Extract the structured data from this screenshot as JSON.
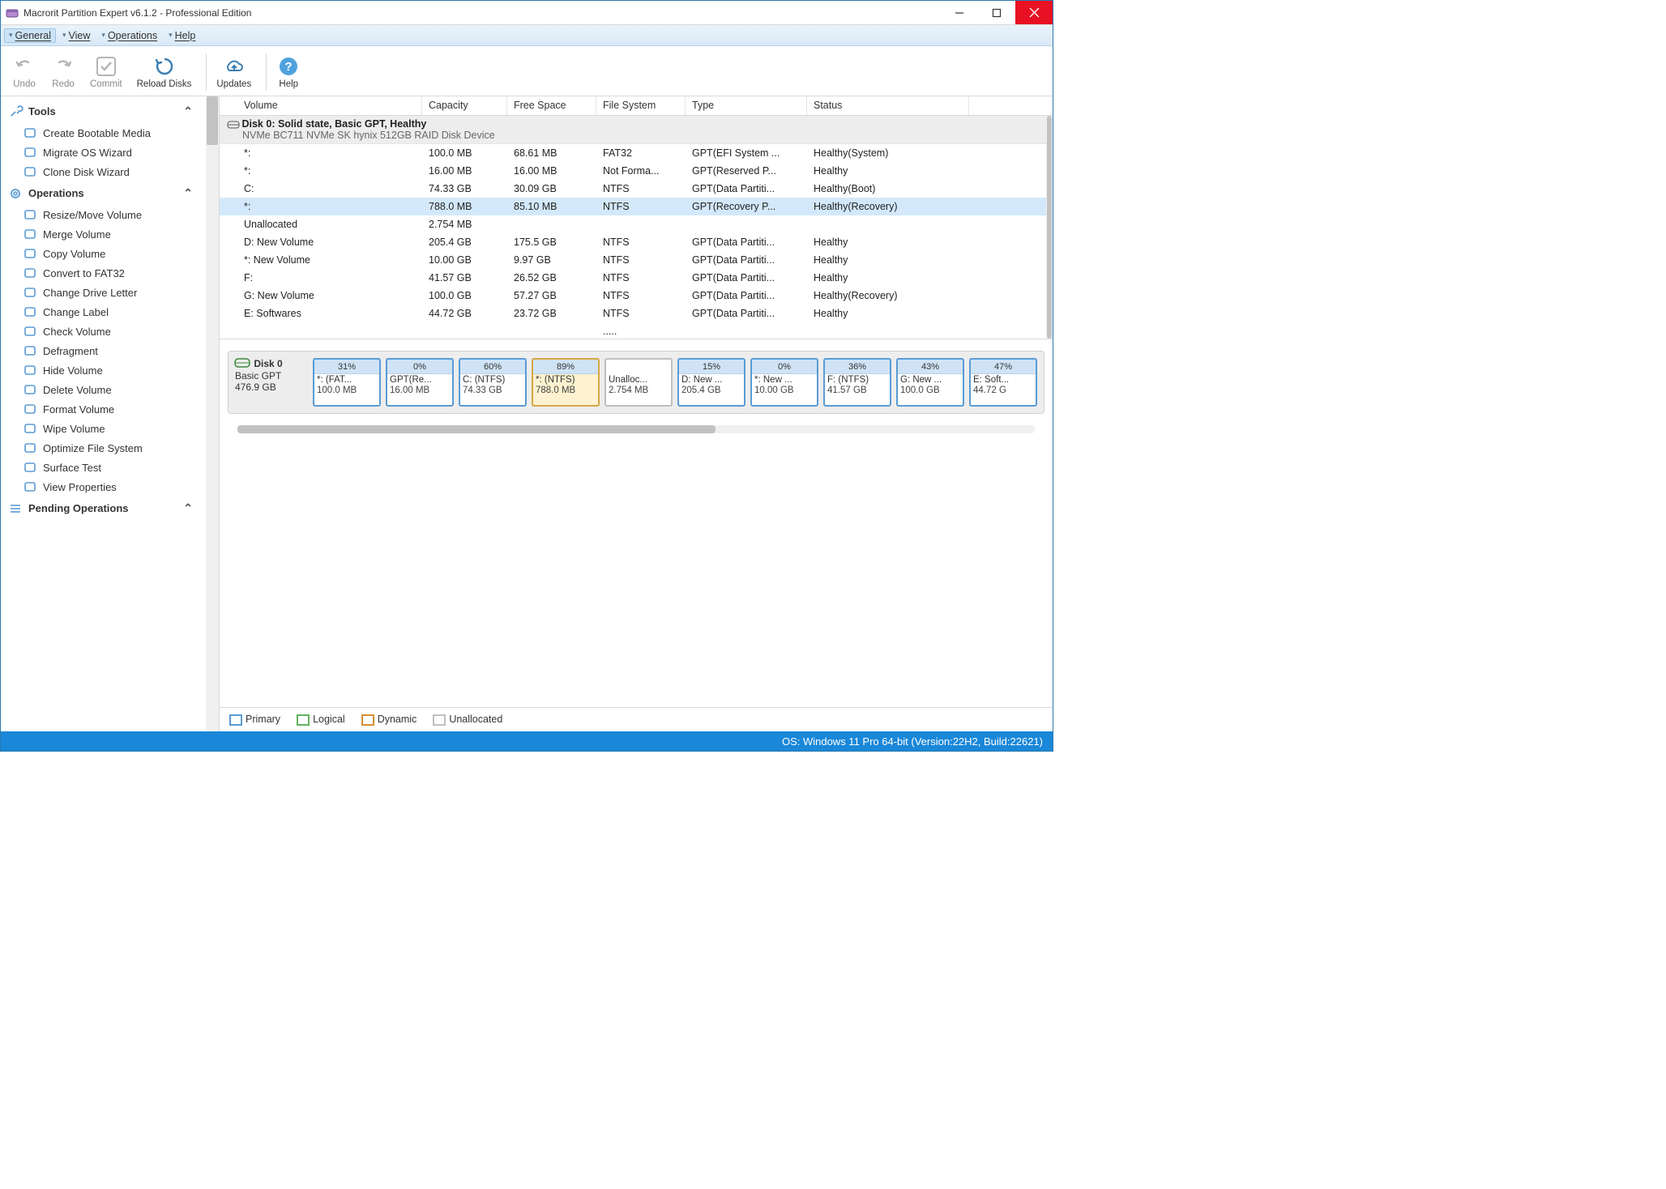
{
  "window": {
    "title": "Macrorit Partition Expert v6.1.2 - Professional Edition"
  },
  "menus": {
    "general": "General",
    "view": "View",
    "operations": "Operations",
    "help": "Help"
  },
  "toolbar": {
    "undo": "Undo",
    "redo": "Redo",
    "commit": "Commit",
    "reload": "Reload Disks",
    "updates": "Updates",
    "help": "Help"
  },
  "sidebar": {
    "tools": {
      "label": "Tools",
      "items": [
        {
          "icon": "usb",
          "label": "Create Bootable Media"
        },
        {
          "icon": "migrate",
          "label": "Migrate OS Wizard"
        },
        {
          "icon": "clone",
          "label": "Clone Disk Wizard"
        }
      ]
    },
    "operations": {
      "label": "Operations",
      "items": [
        {
          "icon": "resize",
          "label": "Resize/Move Volume"
        },
        {
          "icon": "merge",
          "label": "Merge Volume"
        },
        {
          "icon": "copy",
          "label": "Copy Volume"
        },
        {
          "icon": "convert",
          "label": "Convert to FAT32"
        },
        {
          "icon": "letter",
          "label": "Change Drive Letter"
        },
        {
          "icon": "label",
          "label": "Change Label"
        },
        {
          "icon": "check",
          "label": "Check Volume"
        },
        {
          "icon": "defrag",
          "label": "Defragment"
        },
        {
          "icon": "hide",
          "label": "Hide Volume"
        },
        {
          "icon": "delete",
          "label": "Delete Volume"
        },
        {
          "icon": "format",
          "label": "Format Volume"
        },
        {
          "icon": "wipe",
          "label": "Wipe Volume"
        },
        {
          "icon": "optimize",
          "label": "Optimize File System"
        },
        {
          "icon": "surface",
          "label": "Surface Test"
        },
        {
          "icon": "props",
          "label": "View Properties"
        }
      ]
    },
    "pending": {
      "label": "Pending Operations"
    }
  },
  "table": {
    "headers": {
      "volume": "Volume",
      "capacity": "Capacity",
      "free": "Free Space",
      "fs": "File System",
      "type": "Type",
      "status": "Status"
    },
    "disk_header": {
      "name": "Disk 0: Solid state, Basic GPT, Healthy",
      "model": "NVMe BC711 NVMe SK hynix 512GB RAID Disk Device"
    },
    "rows": [
      {
        "vol": "*:",
        "cap": "100.0 MB",
        "free": "68.61 MB",
        "fs": "FAT32",
        "type": "GPT(EFI System ...",
        "status": "Healthy(System)",
        "sel": false
      },
      {
        "vol": "*:",
        "cap": "16.00 MB",
        "free": "16.00 MB",
        "fs": "Not Forma...",
        "type": "GPT(Reserved P...",
        "status": "Healthy",
        "sel": false
      },
      {
        "vol": "C:",
        "cap": "74.33 GB",
        "free": "30.09 GB",
        "fs": "NTFS",
        "type": "GPT(Data Partiti...",
        "status": "Healthy(Boot)",
        "sel": false
      },
      {
        "vol": "*:",
        "cap": "788.0 MB",
        "free": "85.10 MB",
        "fs": "NTFS",
        "type": "GPT(Recovery P...",
        "status": "Healthy(Recovery)",
        "sel": true
      },
      {
        "vol": "Unallocated",
        "cap": "2.754 MB",
        "free": "",
        "fs": "",
        "type": "",
        "status": "",
        "sel": false
      },
      {
        "vol": "D: New Volume",
        "cap": "205.4 GB",
        "free": "175.5 GB",
        "fs": "NTFS",
        "type": "GPT(Data Partiti...",
        "status": "Healthy",
        "sel": false
      },
      {
        "vol": "*: New Volume",
        "cap": "10.00 GB",
        "free": "9.97 GB",
        "fs": "NTFS",
        "type": "GPT(Data Partiti...",
        "status": "Healthy",
        "sel": false
      },
      {
        "vol": "F:",
        "cap": "41.57 GB",
        "free": "26.52 GB",
        "fs": "NTFS",
        "type": "GPT(Data Partiti...",
        "status": "Healthy",
        "sel": false
      },
      {
        "vol": "G: New Volume",
        "cap": "100.0 GB",
        "free": "57.27 GB",
        "fs": "NTFS",
        "type": "GPT(Data Partiti...",
        "status": "Healthy(Recovery)",
        "sel": false
      },
      {
        "vol": "E: Softwares",
        "cap": "44.72 GB",
        "free": "23.72 GB",
        "fs": "NTFS",
        "type": "GPT(Data Partiti...",
        "status": "Healthy",
        "sel": false
      }
    ],
    "more_fs": "....."
  },
  "diskmap": {
    "disk_label": "Disk 0",
    "disk_sub": "Basic GPT",
    "disk_size": "476.9 GB",
    "parts": [
      {
        "pct": "31%",
        "label": "*: (FAT...",
        "size": "100.0 MB",
        "sel": false,
        "unalloc": false
      },
      {
        "pct": "0%",
        "label": "GPT(Re...",
        "size": "16.00 MB",
        "sel": false,
        "unalloc": false
      },
      {
        "pct": "60%",
        "label": "C: (NTFS)",
        "size": "74.33 GB",
        "sel": false,
        "unalloc": false
      },
      {
        "pct": "89%",
        "label": "*: (NTFS)",
        "size": "788.0 MB",
        "sel": true,
        "unalloc": false
      },
      {
        "pct": "",
        "label": "Unalloc...",
        "size": "2.754 MB",
        "sel": false,
        "unalloc": true
      },
      {
        "pct": "15%",
        "label": "D: New ...",
        "size": "205.4 GB",
        "sel": false,
        "unalloc": false
      },
      {
        "pct": "0%",
        "label": "*: New ...",
        "size": "10.00 GB",
        "sel": false,
        "unalloc": false
      },
      {
        "pct": "36%",
        "label": "F: (NTFS)",
        "size": "41.57 GB",
        "sel": false,
        "unalloc": false
      },
      {
        "pct": "43%",
        "label": "G: New ...",
        "size": "100.0 GB",
        "sel": false,
        "unalloc": false
      },
      {
        "pct": "47%",
        "label": "E: Soft...",
        "size": "44.72 G",
        "sel": false,
        "unalloc": false
      }
    ]
  },
  "legend": {
    "primary": "Primary",
    "logical": "Logical",
    "dynamic": "Dynamic",
    "unalloc": "Unallocated"
  },
  "statusbar": "OS: Windows 11 Pro 64-bit (Version:22H2, Build:22621)"
}
